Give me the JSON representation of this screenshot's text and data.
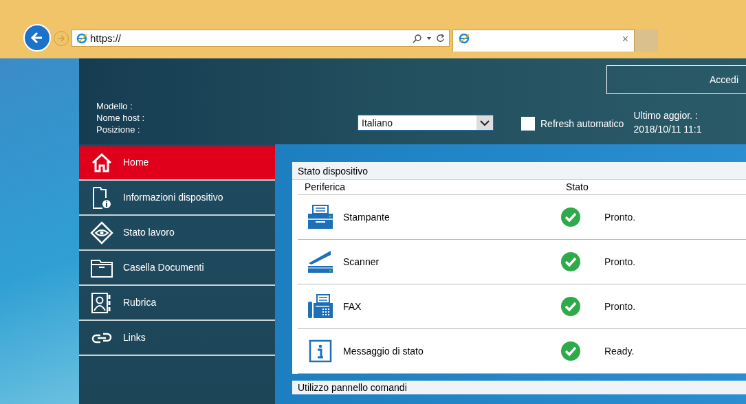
{
  "browser": {
    "address": {
      "value": "https://"
    },
    "tab": {
      "close": "×"
    }
  },
  "header": {
    "device_labels": [
      "Modello :",
      "Nome host :",
      "Posizione :"
    ],
    "language": {
      "value": "Italiano"
    },
    "auto_refresh": {
      "label": "Refresh automatico",
      "checked": false
    },
    "last_update": {
      "label": "Ultimo aggior. :",
      "value": "2018/10/11 11:1"
    },
    "login_button": "Accedi"
  },
  "sidebar": {
    "items": [
      {
        "kind": "home",
        "label": "Home",
        "selected": true
      },
      {
        "kind": "device-info",
        "label": "Informazioni dispositivo",
        "selected": false
      },
      {
        "kind": "job-status",
        "label": "Stato lavoro",
        "selected": false
      },
      {
        "kind": "document-box",
        "label": "Casella Documenti",
        "selected": false
      },
      {
        "kind": "address-book",
        "label": "Rubrica",
        "selected": false
      },
      {
        "kind": "links",
        "label": "Links",
        "selected": false
      }
    ]
  },
  "device_status": {
    "title": "Stato dispositivo",
    "columns": [
      "Periferica",
      "Stato"
    ],
    "rows": [
      {
        "kind": "printer",
        "name": "Stampante",
        "ready": true,
        "message": "Pronto."
      },
      {
        "kind": "scanner",
        "name": "Scanner",
        "ready": true,
        "message": "Pronto."
      },
      {
        "kind": "fax",
        "name": "FAX",
        "ready": true,
        "message": "Pronto."
      },
      {
        "kind": "info",
        "name": "Messaggio di stato",
        "ready": true,
        "message": "Ready."
      }
    ]
  },
  "next_section": {
    "title": "Utilizzo pannello comandi"
  }
}
